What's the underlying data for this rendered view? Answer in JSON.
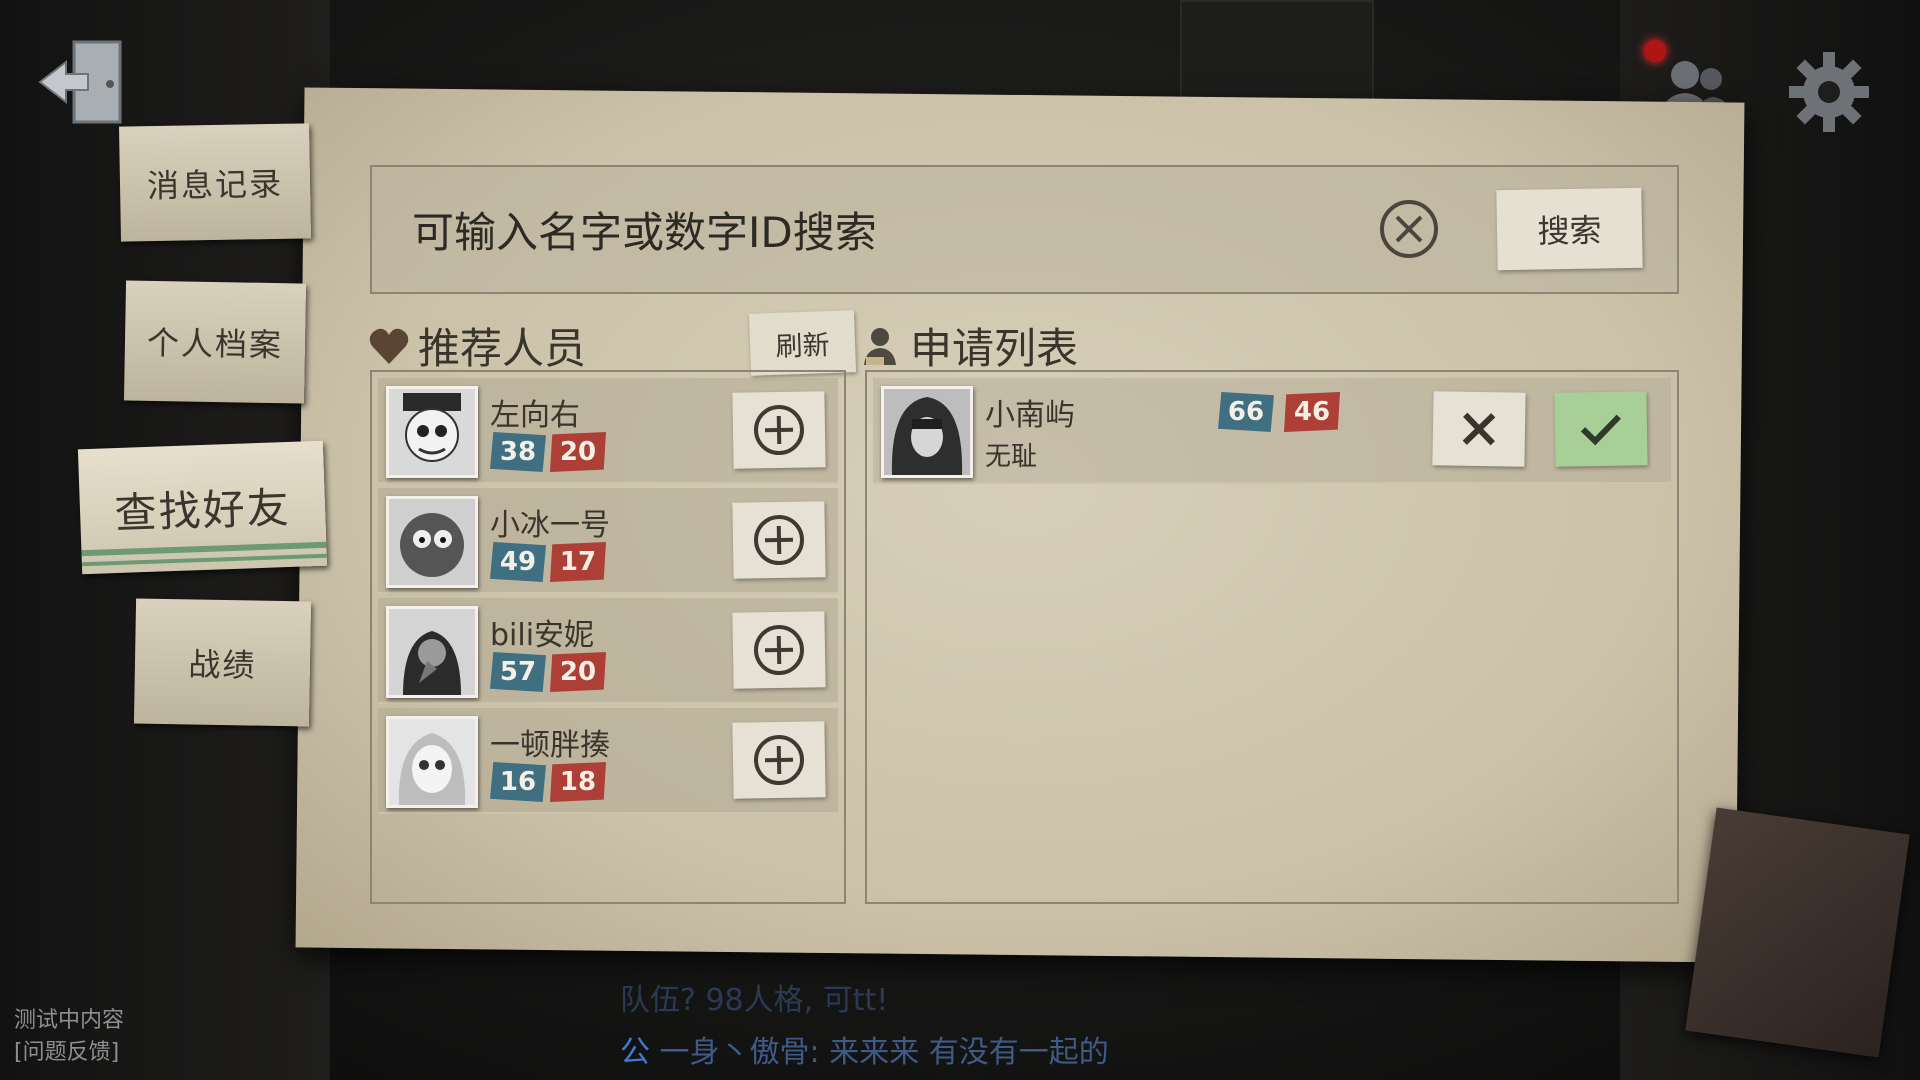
{
  "nav": {
    "tabs": [
      {
        "label": "消息记录"
      },
      {
        "label": "个人档案"
      },
      {
        "label": "查找好友"
      },
      {
        "label": "战绩"
      }
    ],
    "active_tab": "查找好友"
  },
  "search": {
    "placeholder": "可输入名字或数字ID搜索",
    "button_label": "搜索"
  },
  "recommended": {
    "title": "推荐人员",
    "refresh_label": "刷新",
    "people": [
      {
        "name": "左向右",
        "blue": "38",
        "red": "20"
      },
      {
        "name": "小冰一号",
        "blue": "49",
        "red": "17"
      },
      {
        "name": "bili安妮",
        "blue": "57",
        "red": "20"
      },
      {
        "name": "一顿胖揍",
        "blue": "16",
        "red": "18"
      }
    ]
  },
  "requests": {
    "title": "申请列表",
    "items": [
      {
        "name": "小南屿",
        "message": "无耻",
        "blue": "66",
        "red": "46"
      }
    ]
  },
  "chat": {
    "line1": "队伍? 98人格, 可tt!",
    "line2_tag": "公",
    "line2": "一身丶傲骨: 来来来  有没有一起的"
  },
  "footer": {
    "test_note": "测试中内容",
    "feedback": "[问题反馈]"
  },
  "colors": {
    "paper": "#cfc6ae",
    "badge_blue": "#3f6f80",
    "badge_red": "#ad3f36",
    "accept_green": "#a8cf98",
    "tab_stripe_green": "#6c9a72",
    "notification_dot": "#b01515"
  },
  "icons": {
    "exit": "exit-door-icon",
    "friends": "friends-icon",
    "settings": "gear-icon",
    "clear": "clear-x-icon",
    "add": "add-plus-icon",
    "reject": "reject-x-icon",
    "accept": "accept-check-icon",
    "recommend": "heart-icon",
    "request": "person-icon"
  }
}
